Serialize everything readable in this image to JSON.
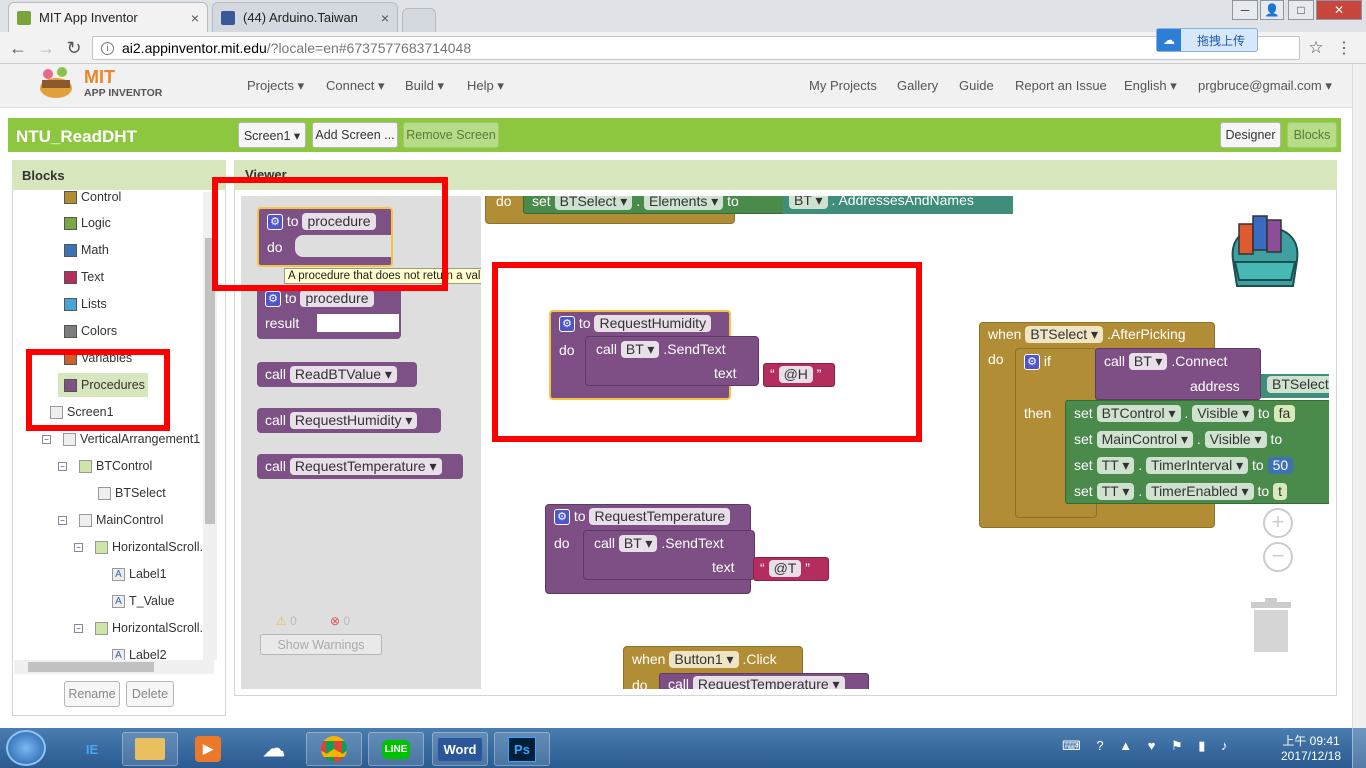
{
  "browser": {
    "tabs": [
      {
        "title": "MIT App Inventor",
        "close": "×"
      },
      {
        "title": "(44) Arduino.Taiwan",
        "close": "×"
      }
    ],
    "window_controls": [
      "─",
      "□",
      "✕"
    ],
    "url_host": "ai2.appinventor.mit.edu",
    "url_path": "/?locale=en#6737577683714048",
    "upload_label": "拖拽上传"
  },
  "header": {
    "logo_main": "MIT",
    "logo_sub": "APP INVENTOR",
    "menus": [
      "Projects ▾",
      "Connect ▾",
      "Build ▾",
      "Help ▾"
    ],
    "right_links": [
      "My Projects",
      "Gallery",
      "Guide",
      "Report an Issue",
      "English ▾",
      "prgbruce@gmail.com ▾"
    ]
  },
  "toolbar": {
    "project_name": "NTU_ReadDHT",
    "screen_select": "Screen1 ▾",
    "add_screen": "Add Screen ...",
    "remove_screen": "Remove Screen",
    "designer": "Designer",
    "blocks": "Blocks"
  },
  "blocks_panel": {
    "title": "Blocks",
    "categories": [
      {
        "label": "Control",
        "color": "#b18e35"
      },
      {
        "label": "Logic",
        "color": "#77ab41"
      },
      {
        "label": "Math",
        "color": "#3f71b5"
      },
      {
        "label": "Text",
        "color": "#b32d5e"
      },
      {
        "label": "Lists",
        "color": "#49a6d4"
      },
      {
        "label": "Colors",
        "color": "#7d7d7d"
      },
      {
        "label": "Variables",
        "color": "#d05f2d"
      },
      {
        "label": "Procedures",
        "color": "#7c5385"
      }
    ],
    "components": [
      "Screen1",
      "VerticalArrangement1",
      "BTControl",
      "BTSelect",
      "MainControl",
      "HorizontalScroll...",
      "Label1",
      "T_Value",
      "HorizontalScroll...",
      "Label2"
    ],
    "rename": "Rename",
    "delete": "Delete"
  },
  "viewer": {
    "title": "Viewer",
    "warnings_count": "0",
    "errors_count": "0",
    "show_warnings": "Show Warnings"
  },
  "drawer": {
    "to": "to",
    "procedure": "procedure",
    "do": "do",
    "result": "result",
    "tooltip": "A procedure that does not return a value",
    "calls": [
      "call",
      "ReadBTValue",
      "RequestHumidity",
      "RequestTemperature"
    ]
  },
  "canvas": {
    "top_block": {
      "do": "do",
      "set": "set",
      "target": "BTSelect",
      "prop": "Elements",
      "to": "to",
      "comp": "BT",
      "value": "AddressesAndNames"
    },
    "humidity": {
      "to": "to",
      "name": "RequestHumidity",
      "do": "do",
      "call": "call",
      "comp": "BT",
      "method": ".SendText",
      "text": "text",
      "value": "@H"
    },
    "temperature": {
      "to": "to",
      "name": "RequestTemperature",
      "do": "do",
      "call": "call",
      "comp": "BT",
      "method": ".SendText",
      "text": "text",
      "value": "@T"
    },
    "button": {
      "when": "when",
      "comp": "Button1",
      "event": ".Click",
      "do": "do",
      "call": "call",
      "proc": "RequestTemperature"
    },
    "afterpicking": {
      "when": "when",
      "comp": "BTSelect",
      "event": ".AfterPicking",
      "do": "do",
      "if": "if",
      "then": "then",
      "call": "call",
      "bt": "BT",
      "connect": ".Connect",
      "address": "address",
      "address_value": "BTSelect",
      "sets": [
        {
          "set": "set",
          "comp": "BTControl",
          "prop": "Visible",
          "to": "to",
          "value": "fa"
        },
        {
          "set": "set",
          "comp": "MainControl",
          "prop": "Visible",
          "to": "to",
          "value": ""
        },
        {
          "set": "set",
          "comp": "TT",
          "prop": "TimerInterval",
          "to": "to",
          "value": "50"
        },
        {
          "set": "set",
          "comp": "TT",
          "prop": "TimerEnabled",
          "to": "to",
          "value": "t"
        }
      ]
    },
    "zoom_in": "+",
    "zoom_out": "−"
  },
  "taskbar": {
    "apps": [
      "IE",
      "Explorer",
      "Media",
      "Baidu",
      "Chrome",
      "LINE",
      "Word",
      "Ps"
    ],
    "time": "上午 09:41",
    "date": "2017/12/18"
  }
}
